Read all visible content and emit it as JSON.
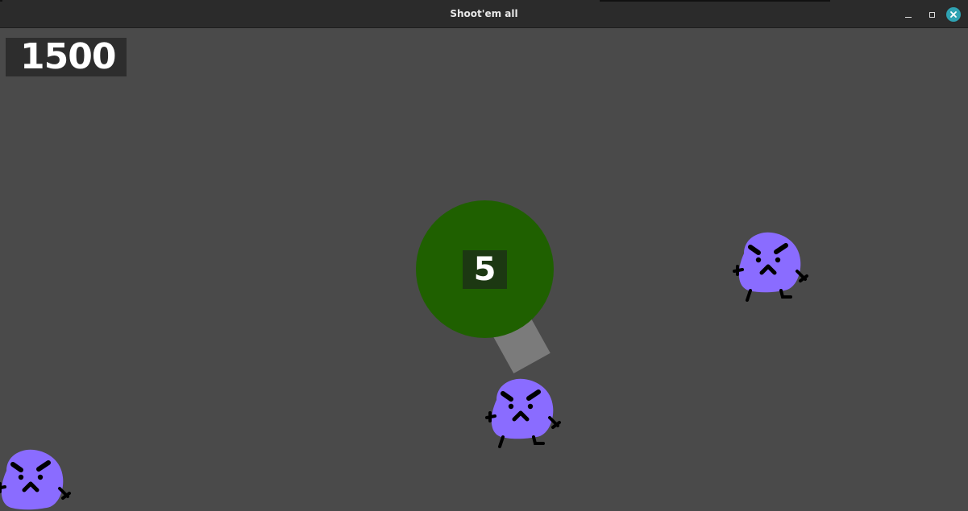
{
  "window": {
    "title": "Shoot'em all"
  },
  "hud": {
    "score": "1500"
  },
  "player": {
    "ammo": "5",
    "body_color": "#1f6000",
    "barrel_color": "#7b7b7b"
  },
  "enemies": {
    "color": "#8a6cff",
    "icon": "angry-blob-icon"
  },
  "colors": {
    "background": "#4a4a4a",
    "titlebar": "#2b2b2b",
    "close_button": "#2fa3b3"
  }
}
